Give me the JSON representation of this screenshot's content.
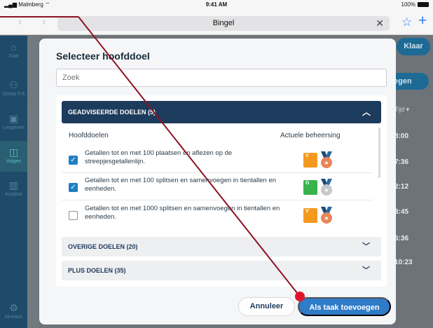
{
  "statusbar": {
    "carrier": "Malmberg",
    "time": "9:41 AM",
    "battery": "100%"
  },
  "browser": {
    "title": "Bingel",
    "back": "‹",
    "forward": "›",
    "clear": "✕",
    "star": "☆",
    "plus": "+"
  },
  "sidebar": {
    "items": [
      {
        "label": "Start",
        "icon": "home-icon",
        "glyph": "⌂"
      },
      {
        "label": "Groep 5-6",
        "icon": "group-icon",
        "glyph": "⚇"
      },
      {
        "label": "Lesgeven",
        "icon": "lesson-icon",
        "glyph": "▣"
      },
      {
        "label": "Volgen",
        "icon": "follow-icon",
        "glyph": "◫"
      },
      {
        "label": "Analyse",
        "icon": "analysis-icon",
        "glyph": "▥"
      },
      {
        "label": "Niveaus",
        "icon": "gear-icon",
        "glyph": "⚙"
      }
    ]
  },
  "background": {
    "klaar": "Klaar",
    "agen": "egen",
    "tijd": "Tijd ▾",
    "times": [
      "8:00",
      "7:36",
      "2:12",
      "3:45",
      "6:36",
      "10:23"
    ]
  },
  "modal": {
    "title": "Selecteer hoofddoel",
    "search_placeholder": "Zoek",
    "section_title": "GEADVISEERDE DOELEN (5)",
    "col_goals": "Hoofddoelen",
    "col_mastery": "Actuele beheersing",
    "goals": [
      {
        "text": "Getallen tot en met 100 plaatsen en aflezen op de streepjesgetallenlijn.",
        "checked": true,
        "badge": "V",
        "badge_color": "#f39a1e",
        "medal_color": "#e9855a"
      },
      {
        "text": "Getallen tot en met 100 splitsen en samenvoegen in tientallen en eenheden.",
        "checked": true,
        "badge": "G",
        "badge_color": "#36b34a",
        "medal_color": "#c5c8cc"
      },
      {
        "text": "Getallen tot en met 1000 splitsen en samenvoegen in tientallen en eenheden.",
        "checked": false,
        "badge": "V",
        "badge_color": "#f39a1e",
        "medal_color": "#e9855a"
      }
    ],
    "other_sections": [
      "OVERIGE DOELEN (20)",
      "PLUS DOELEN (35)"
    ],
    "cancel": "Annuleer",
    "add": "Als taak toevoegen"
  }
}
